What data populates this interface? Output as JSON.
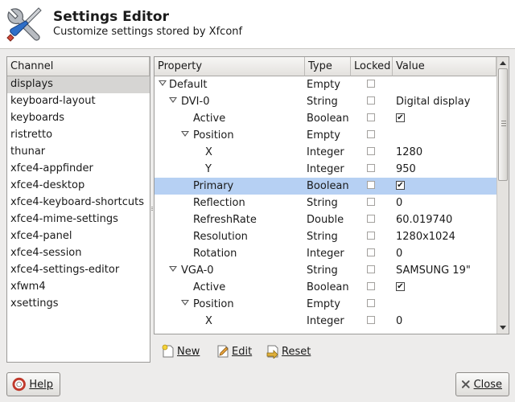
{
  "header": {
    "title": "Settings Editor",
    "subtitle": "Customize settings stored by Xfconf",
    "icon": "screwdriver-wrench-icon"
  },
  "channels": {
    "header": "Channel",
    "selected": "displays",
    "items": [
      "displays",
      "keyboard-layout",
      "keyboards",
      "ristretto",
      "thunar",
      "xfce4-appfinder",
      "xfce4-desktop",
      "xfce4-keyboard-shortcuts",
      "xfce4-mime-settings",
      "xfce4-panel",
      "xfce4-session",
      "xfce4-settings-editor",
      "xfwm4",
      "xsettings"
    ]
  },
  "properties": {
    "columns": {
      "property": "Property",
      "type": "Type",
      "locked": "Locked",
      "value": "Value"
    },
    "rows": [
      {
        "name": "Default",
        "type": "Empty",
        "value": "",
        "depth": 0,
        "expander": true
      },
      {
        "name": "DVI-0",
        "type": "String",
        "value": "Digital display",
        "depth": 1,
        "expander": true
      },
      {
        "name": "Active",
        "type": "Boolean",
        "value": "true",
        "depth": 2,
        "expander": false
      },
      {
        "name": "Position",
        "type": "Empty",
        "value": "",
        "depth": 2,
        "expander": true
      },
      {
        "name": "X",
        "type": "Integer",
        "value": "1280",
        "depth": 3,
        "expander": false
      },
      {
        "name": "Y",
        "type": "Integer",
        "value": "950",
        "depth": 3,
        "expander": false
      },
      {
        "name": "Primary",
        "type": "Boolean",
        "value": "true",
        "depth": 2,
        "expander": false,
        "selected": true
      },
      {
        "name": "Reflection",
        "type": "String",
        "value": "0",
        "depth": 2,
        "expander": false
      },
      {
        "name": "RefreshRate",
        "type": "Double",
        "value": "60.019740",
        "depth": 2,
        "expander": false
      },
      {
        "name": "Resolution",
        "type": "String",
        "value": "1280x1024",
        "depth": 2,
        "expander": false
      },
      {
        "name": "Rotation",
        "type": "Integer",
        "value": "0",
        "depth": 2,
        "expander": false
      },
      {
        "name": "VGA-0",
        "type": "String",
        "value": "SAMSUNG 19\"",
        "depth": 1,
        "expander": true
      },
      {
        "name": "Active",
        "type": "Boolean",
        "value": "true",
        "depth": 2,
        "expander": false
      },
      {
        "name": "Position",
        "type": "Empty",
        "value": "",
        "depth": 2,
        "expander": true
      },
      {
        "name": "X",
        "type": "Integer",
        "value": "0",
        "depth": 3,
        "expander": false
      }
    ]
  },
  "toolbar": {
    "new_label": "New",
    "edit_label": "Edit",
    "reset_label": "Reset"
  },
  "footer": {
    "help_label": "Help",
    "close_label": "Close"
  },
  "colors": {
    "selection_row": "#b6d0f3",
    "channel_selection": "#d6d5d3",
    "window_bg": "#edeceb"
  }
}
